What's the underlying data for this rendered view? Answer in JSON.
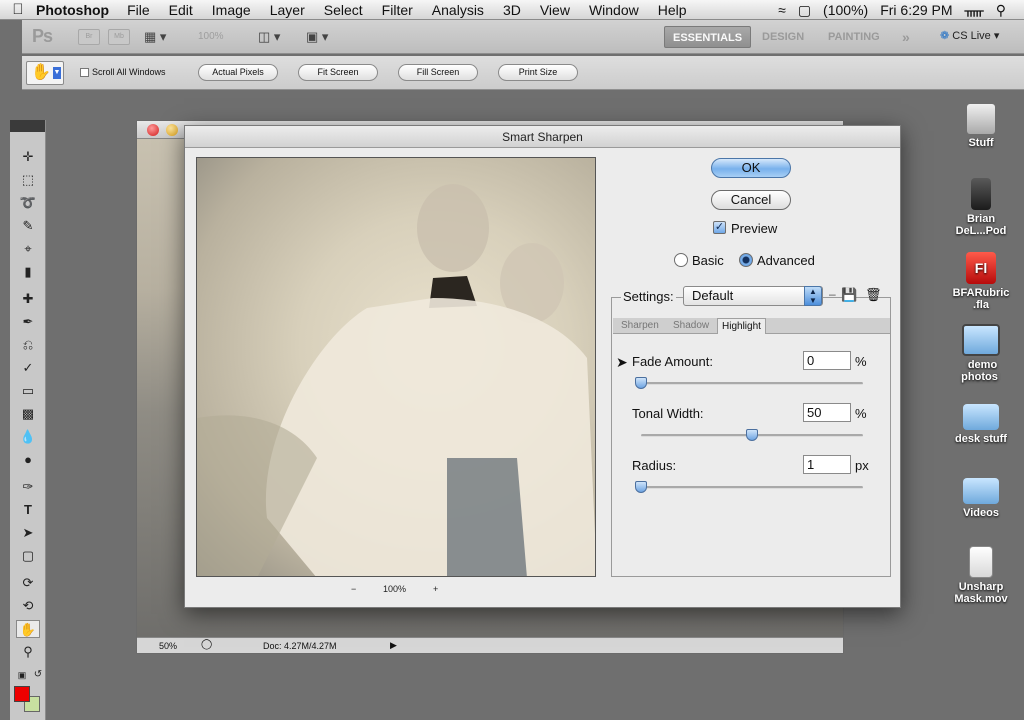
{
  "menubar": {
    "app": "Photoshop",
    "items": [
      "File",
      "Edit",
      "Image",
      "Layer",
      "Select",
      "Filter",
      "Analysis",
      "3D",
      "View",
      "Window",
      "Help"
    ],
    "battery": "(100%)",
    "clock": "Fri 6:29 PM"
  },
  "appbar": {
    "logo": "Ps",
    "br": "Br",
    "mb": "Mb",
    "zoom": "100%",
    "workspaces": [
      "ESSENTIALS",
      "DESIGN",
      "PAINTING"
    ],
    "more": "»",
    "cslive": "CS Live"
  },
  "options": {
    "scroll_all": "Scroll All Windows",
    "buttons": [
      "Actual Pixels",
      "Fit Screen",
      "Fill Screen",
      "Print Size"
    ]
  },
  "document": {
    "zoom": "50%",
    "doc_info": "Doc: 4.27M/4.27M"
  },
  "dialog": {
    "title": "Smart Sharpen",
    "ok": "OK",
    "cancel": "Cancel",
    "preview_label": "Preview",
    "preview_checked": true,
    "mode_basic": "Basic",
    "mode_advanced": "Advanced",
    "mode_selected": "Advanced",
    "settings_label": "Settings:",
    "settings_value": "Default",
    "tabs": [
      "Sharpen",
      "Shadow",
      "Highlight"
    ],
    "active_tab": "Highlight",
    "zoom_minus": "−",
    "zoom_value": "100%",
    "zoom_plus": "+",
    "fade": {
      "label": "Fade Amount:",
      "value": "0",
      "unit": "%",
      "level": 0.0
    },
    "tonal": {
      "label": "Tonal Width:",
      "value": "50",
      "unit": "%",
      "level": 0.5
    },
    "radius": {
      "label": "Radius:",
      "value": "1",
      "unit": "px",
      "level": 0.0
    }
  },
  "desktop": [
    {
      "label": "Stuff"
    },
    {
      "label": "Brian DeL...Pod"
    },
    {
      "label": "BFARubric .fla"
    },
    {
      "label": "demo photos"
    },
    {
      "label": "desk stuff"
    },
    {
      "label": "Videos"
    },
    {
      "label": "Unsharp Mask.mov"
    }
  ]
}
